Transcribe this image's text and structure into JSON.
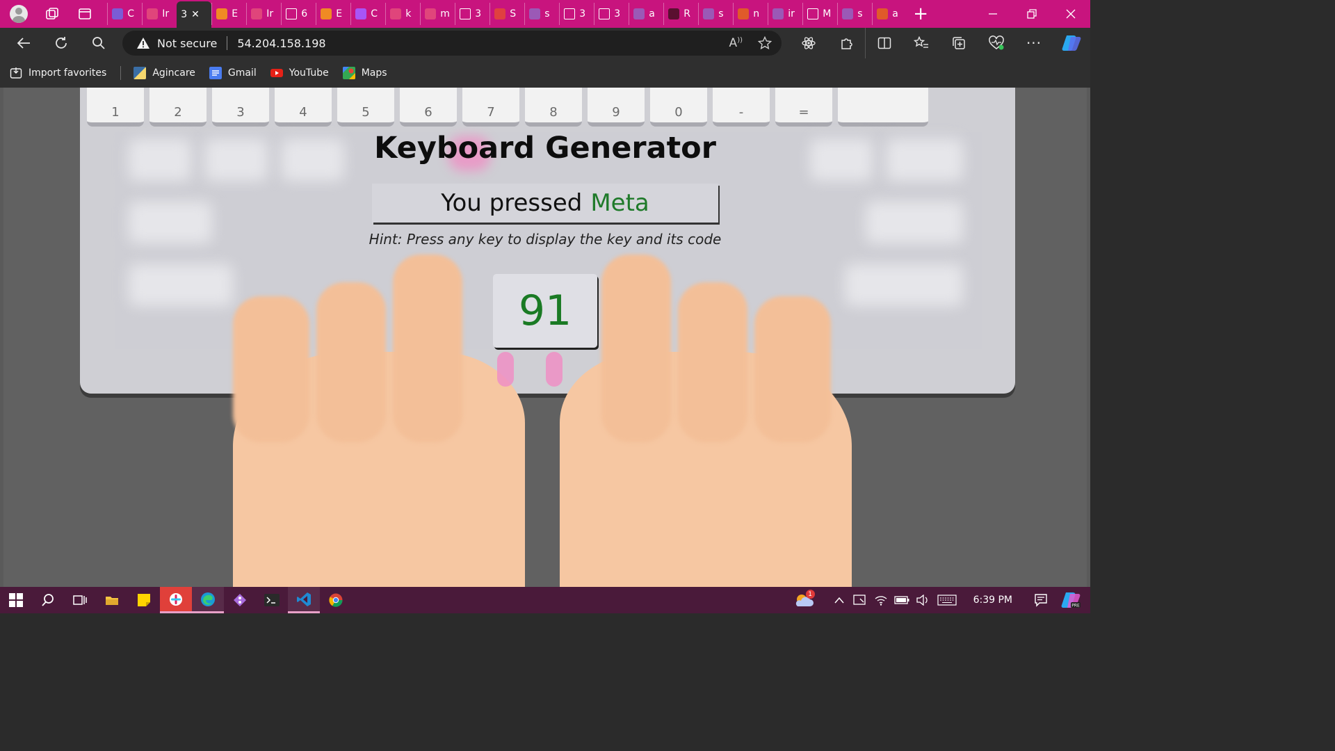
{
  "browser": {
    "tabs": [
      {
        "title": "C",
        "color": "#7b5cd6"
      },
      {
        "title": "Ir",
        "color": "#e0457b"
      },
      {
        "title": "3",
        "color": "#2f2f2f",
        "active": true
      },
      {
        "title": "E",
        "color": "#f08a24"
      },
      {
        "title": "Ir",
        "color": "#e0457b"
      },
      {
        "title": "6",
        "color": "#ffffff"
      },
      {
        "title": "E",
        "color": "#f08a24"
      },
      {
        "title": "C",
        "color": "#a855f7"
      },
      {
        "title": "k",
        "color": "#e0457b"
      },
      {
        "title": "m",
        "color": "#e0457b"
      },
      {
        "title": "3",
        "color": "#ffffff"
      },
      {
        "title": "S",
        "color": "#e04040"
      },
      {
        "title": "s",
        "color": "#9b59b6"
      },
      {
        "title": "3",
        "color": "#ffffff"
      },
      {
        "title": "3",
        "color": "#ffffff"
      },
      {
        "title": "a",
        "color": "#9b59b6"
      },
      {
        "title": "R",
        "color": "#5a1030"
      },
      {
        "title": "s",
        "color": "#9b59b6"
      },
      {
        "title": "n",
        "color": "#e05a2a"
      },
      {
        "title": "ir",
        "color": "#9b59b6"
      },
      {
        "title": "M",
        "color": "#ffffff"
      },
      {
        "title": "s",
        "color": "#9b59b6"
      },
      {
        "title": "a",
        "color": "#e05a2a"
      }
    ],
    "new_tab": "+",
    "security_label": "Not secure",
    "url": "54.204.158.198",
    "favorites": [
      {
        "label": "Import favorites"
      },
      {
        "label": "Agincare"
      },
      {
        "label": "Gmail"
      },
      {
        "label": "YouTube"
      },
      {
        "label": "Maps"
      }
    ]
  },
  "page": {
    "title": "Keyboard Generator",
    "pressed_prefix": "You pressed",
    "pressed_key": "Meta",
    "hint": "Hint: Press any key to display the key and its code",
    "key_code": "91",
    "keyboard_number_row": [
      "1",
      "2",
      "3",
      "4",
      "5",
      "6",
      "7",
      "8",
      "9",
      "0",
      "-",
      "="
    ]
  },
  "taskbar": {
    "time": "6:39 PM",
    "weather_badge": "1"
  },
  "colors": {
    "tabstrip": "#c8147e",
    "taskbar": "#4a1a3a",
    "key_name": "#1f7a2a"
  }
}
